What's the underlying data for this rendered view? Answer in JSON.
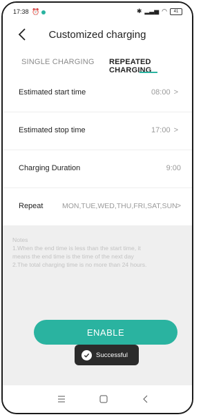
{
  "status_bar": {
    "time": "17:38",
    "battery": "41"
  },
  "header": {
    "title": "Customized charging"
  },
  "tabs": [
    {
      "label": "SINGLE CHARGING",
      "active": false
    },
    {
      "label": "REPEATED CHARGING",
      "active": true
    }
  ],
  "settings": {
    "start": {
      "label": "Estimated start time",
      "value": "08:00"
    },
    "stop": {
      "label": "Estimated stop time",
      "value": "17:00"
    },
    "duration": {
      "label": "Charging Duration",
      "value": "9:00"
    },
    "repeat": {
      "label": "Repeat",
      "value": "MON,TUE,WED,THU,FRI,SAT,SUN"
    }
  },
  "notes": {
    "title": "Notes",
    "line1": "1.When the end time is less than the start time, it",
    "line2": "means the end time is the time of the next day",
    "line3": "2.The total charging time is no more than 24 hours."
  },
  "enable_label": "ENABLE",
  "toast": {
    "text": "Successful"
  },
  "colors": {
    "accent": "#2ab3a0",
    "toast_bg": "#2b2b2b"
  }
}
